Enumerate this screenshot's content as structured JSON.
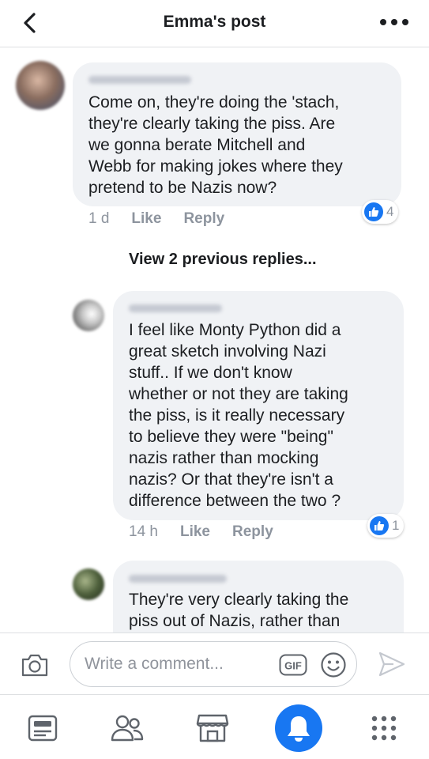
{
  "header": {
    "title": "Emma's post",
    "back_icon": "chevron-left-icon",
    "more_icon": "more-horizontal-icon"
  },
  "comments": [
    {
      "text": "Come on, they're doing the 'stach,\nthey're clearly taking the piss. Are\nwe gonna berate Mitchell and\nWebb for making jokes where they\npretend to be Nazis now?",
      "time": "1 d",
      "like_label": "Like",
      "reply_label": "Reply",
      "reaction_count": "4"
    },
    {
      "text": "I feel like Monty Python did a\ngreat sketch involving Nazi\nstuff.. If we don't know\nwhether or not they are taking\nthe piss, is it really necessary\nto believe they were \"being\"\nnazis rather than mocking\nnazis? Or that they're isn't a\ndifference between the two ?",
      "time": "14 h",
      "like_label": "Like",
      "reply_label": "Reply",
      "reaction_count": "1"
    },
    {
      "text": "They're very clearly taking the\npiss out of Nazis, rather than"
    }
  ],
  "view_previous": "View 2 previous replies...",
  "composer": {
    "placeholder": "Write a comment...",
    "gif_label": "GIF",
    "icons": [
      "camera-icon",
      "gif-icon",
      "emoji-icon",
      "send-icon"
    ]
  },
  "tabbar": {
    "tabs": [
      "news-feed-icon",
      "friends-icon",
      "marketplace-icon",
      "notifications-icon",
      "menu-grid-icon"
    ],
    "active": "notifications-icon"
  },
  "colors": {
    "accent": "#1877f2",
    "bubble": "#f0f2f5",
    "meta_text": "#8d949e",
    "icon_gray": "#5f646b"
  }
}
